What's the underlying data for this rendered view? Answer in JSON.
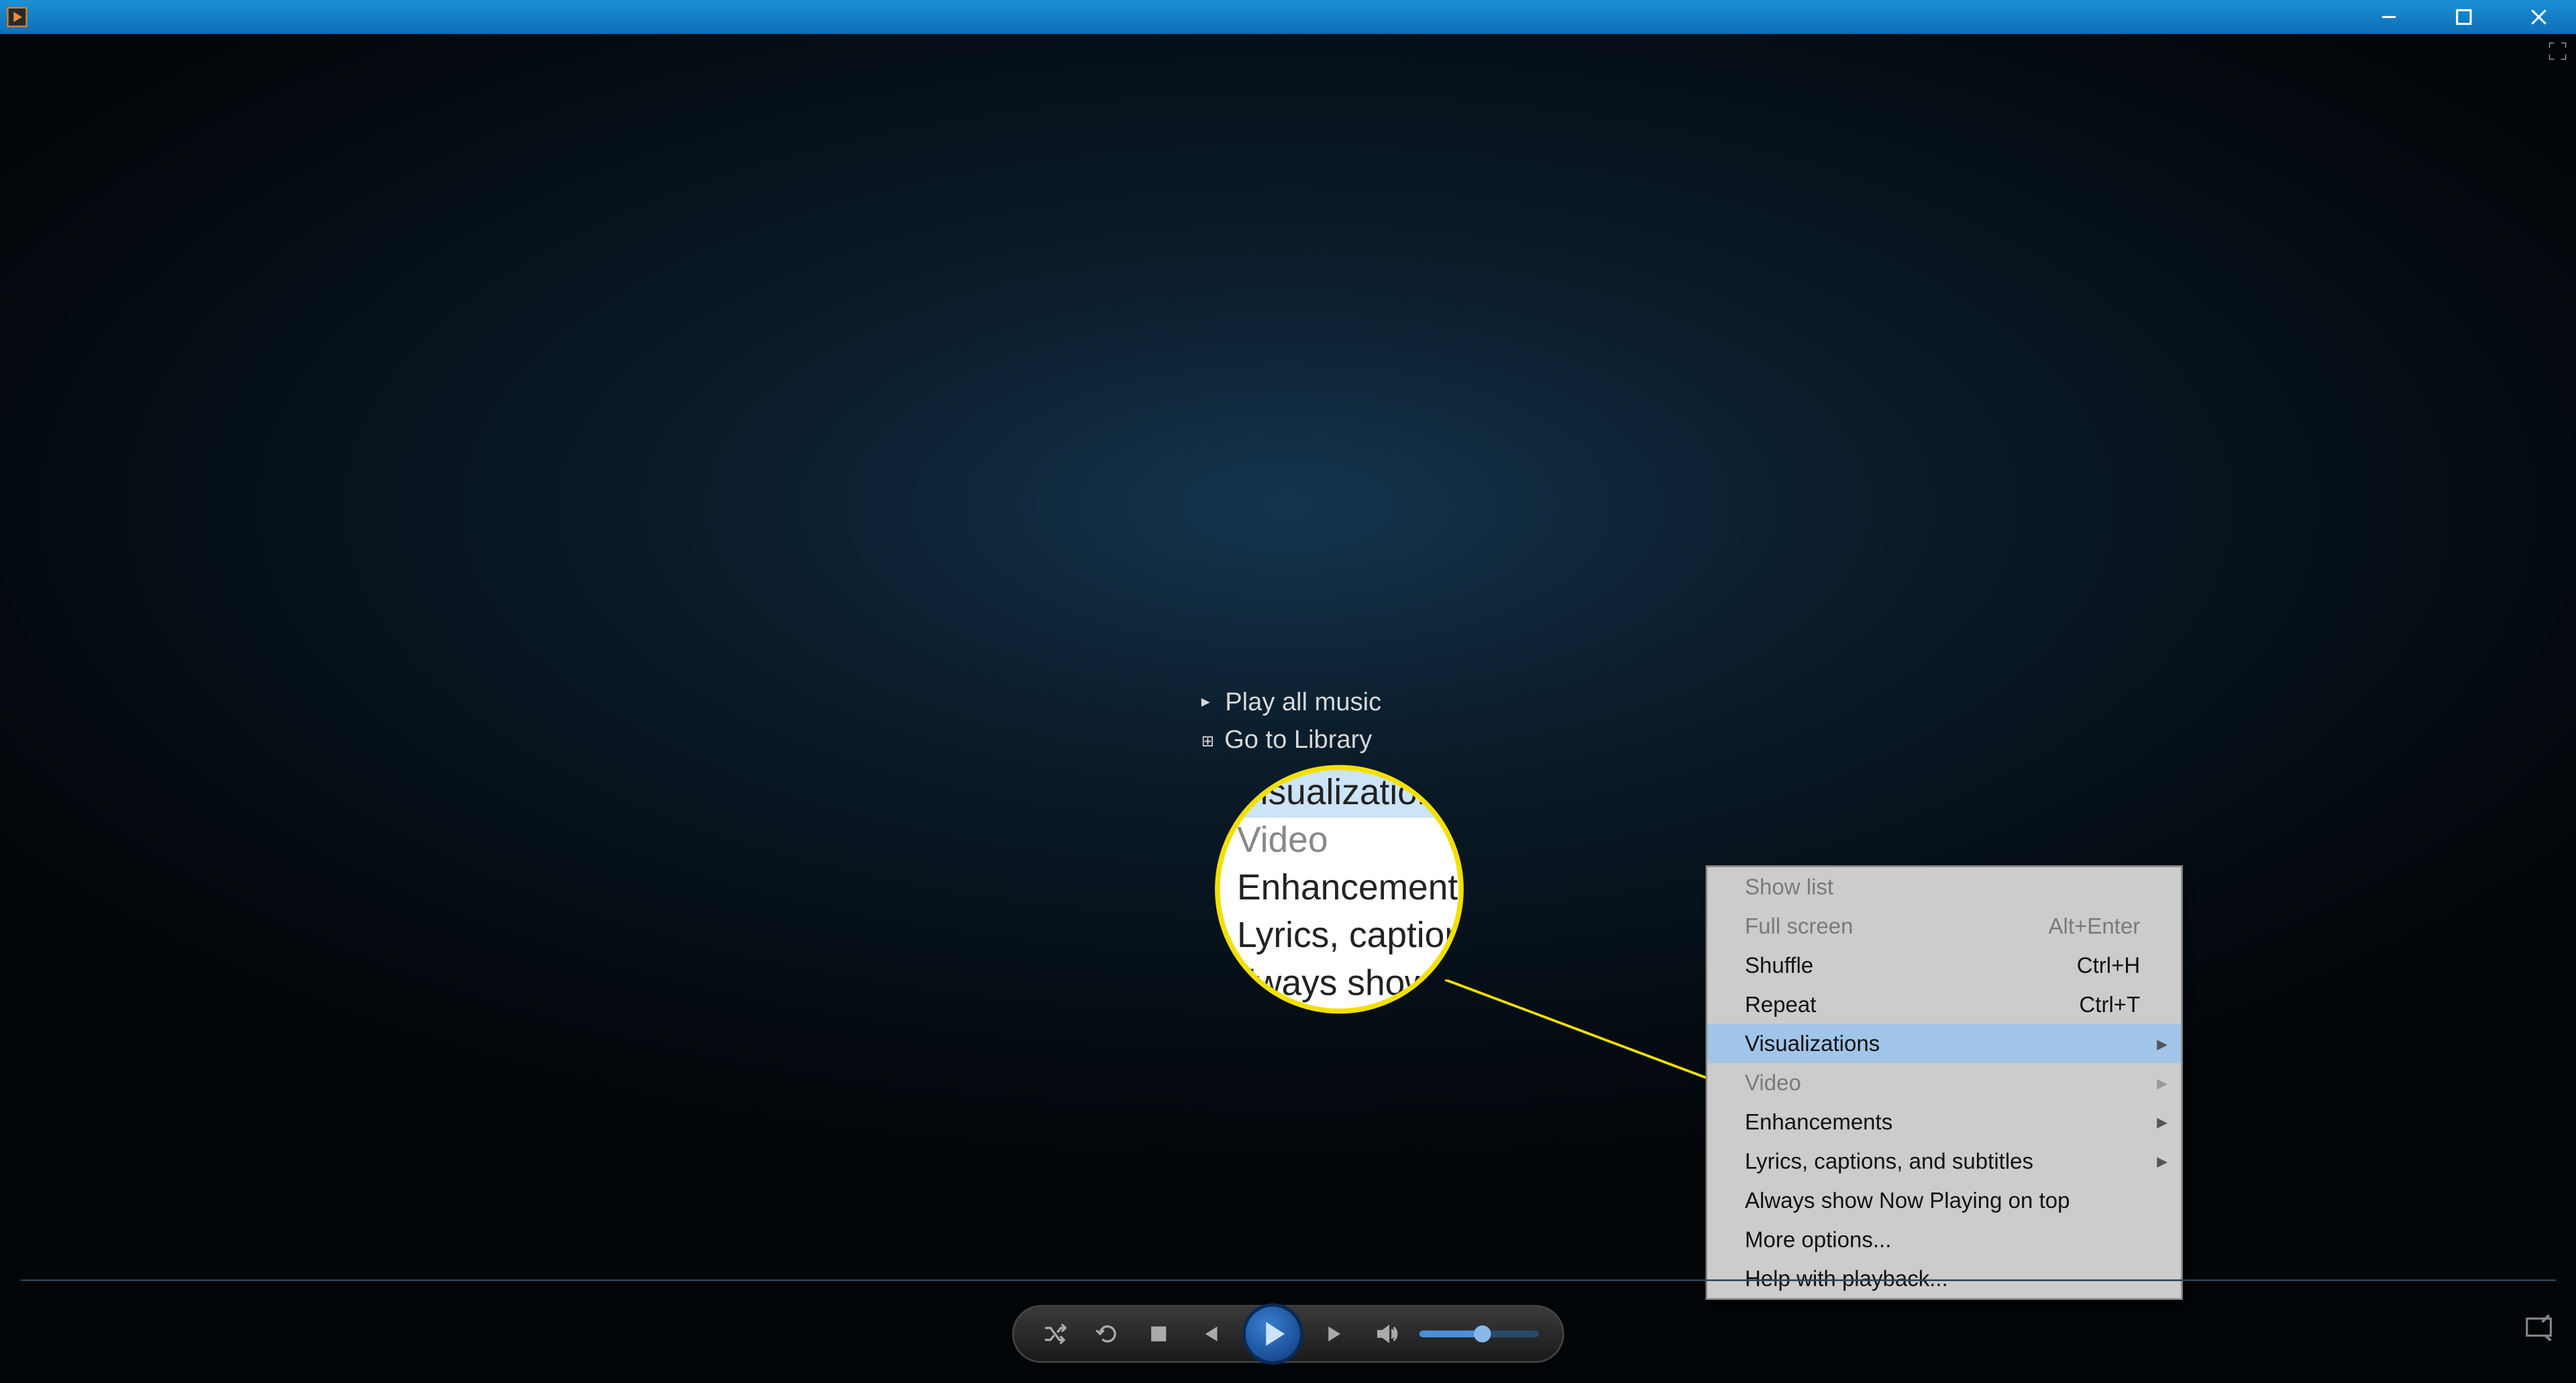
{
  "titlebar": {
    "app_name": "Windows Media Player"
  },
  "center_links": {
    "play_all": "Play all music",
    "go_library": "Go to Library"
  },
  "magnifier": {
    "row1": "Visualizations",
    "row2": "Video",
    "row3": "Enhancements",
    "row4": "Lyrics, captions,",
    "row5": "lways show"
  },
  "context_menu": {
    "items": [
      {
        "label": "Show list",
        "shortcut": "",
        "disabled": true,
        "highlighted": false,
        "submenu": false
      },
      {
        "label": "Full screen",
        "shortcut": "Alt+Enter",
        "disabled": true,
        "highlighted": false,
        "submenu": false
      },
      {
        "label": "Shuffle",
        "shortcut": "Ctrl+H",
        "disabled": false,
        "highlighted": false,
        "submenu": false
      },
      {
        "label": "Repeat",
        "shortcut": "Ctrl+T",
        "disabled": false,
        "highlighted": false,
        "submenu": false
      },
      {
        "label": "Visualizations",
        "shortcut": "",
        "disabled": false,
        "highlighted": true,
        "submenu": true
      },
      {
        "label": "Video",
        "shortcut": "",
        "disabled": true,
        "highlighted": false,
        "submenu": true
      },
      {
        "label": "Enhancements",
        "shortcut": "",
        "disabled": false,
        "highlighted": false,
        "submenu": true
      },
      {
        "label": "Lyrics, captions, and subtitles",
        "shortcut": "",
        "disabled": false,
        "highlighted": false,
        "submenu": true
      },
      {
        "label": "Always show Now Playing on top",
        "shortcut": "",
        "disabled": false,
        "highlighted": false,
        "submenu": false
      },
      {
        "label": "More options...",
        "shortcut": "",
        "disabled": false,
        "highlighted": false,
        "submenu": false
      },
      {
        "label": "Help with playback...",
        "shortcut": "",
        "disabled": false,
        "highlighted": false,
        "submenu": false
      }
    ]
  },
  "controls": {
    "volume_percent": 48
  }
}
